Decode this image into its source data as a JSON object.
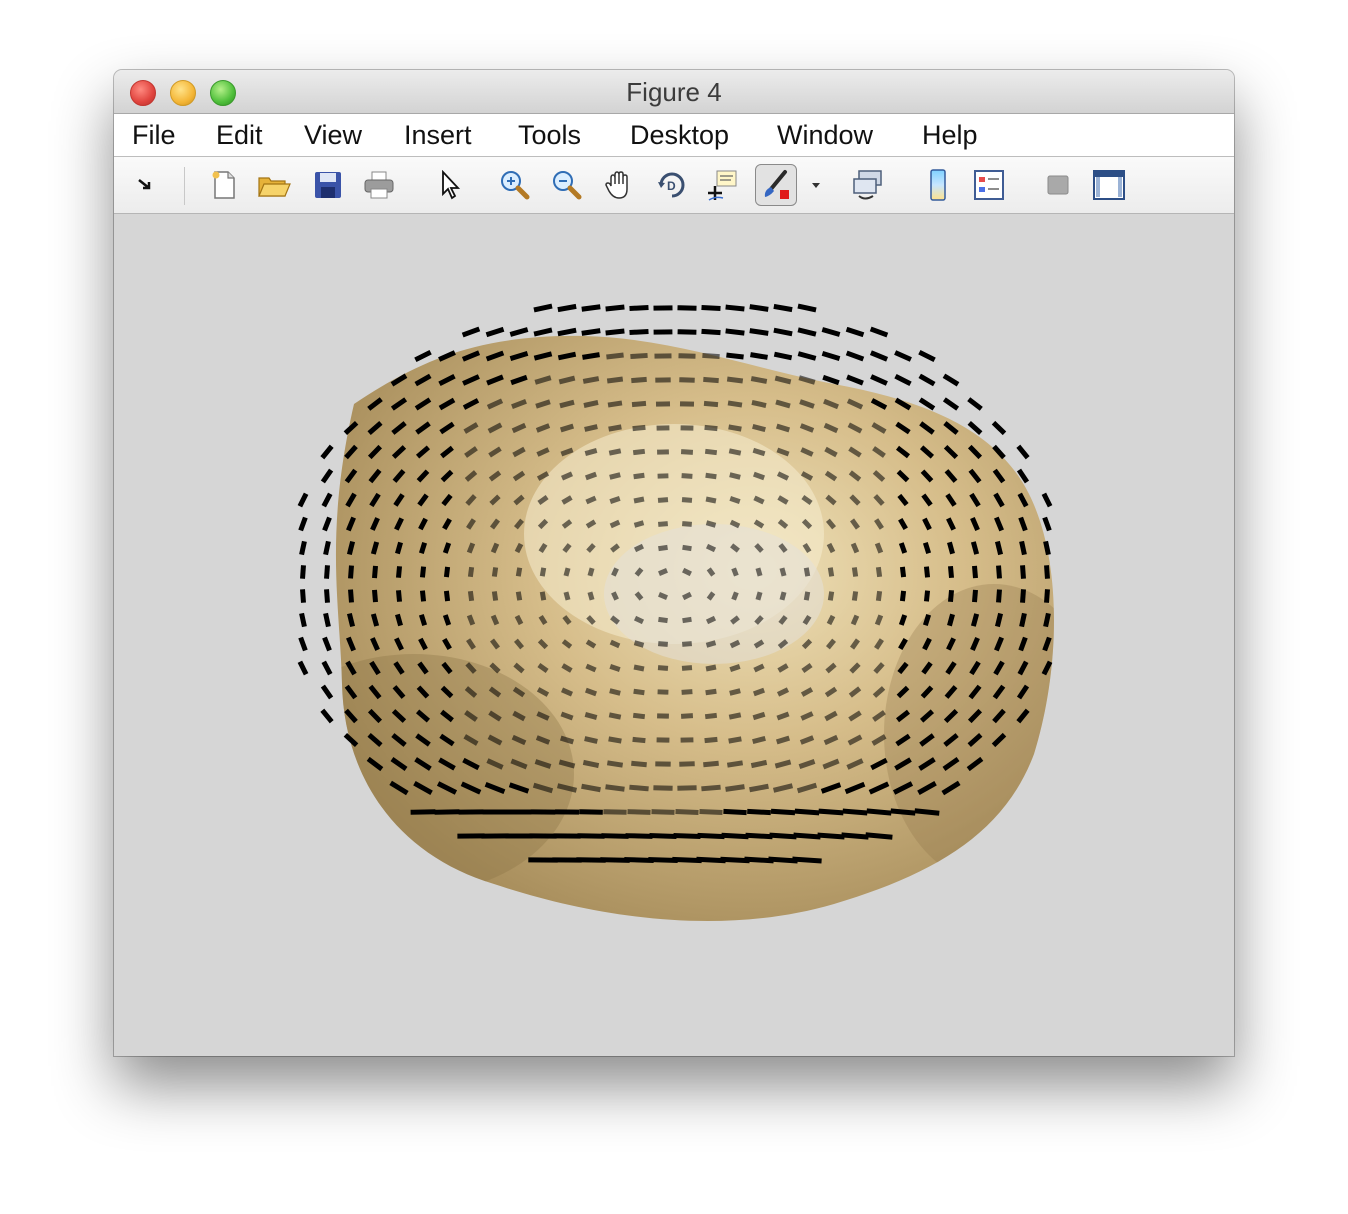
{
  "window": {
    "title": "Figure 4"
  },
  "menu": [
    "File",
    "Edit",
    "View",
    "Insert",
    "Tools",
    "Desktop",
    "Window",
    "Help"
  ],
  "toolbar": {
    "buttons": [
      {
        "name": "dock-icon"
      },
      {
        "name": "new-figure-icon"
      },
      {
        "name": "open-file-icon"
      },
      {
        "name": "save-icon"
      },
      {
        "name": "print-icon"
      },
      {
        "name": "edit-plot-pointer-icon"
      },
      {
        "name": "zoom-in-icon"
      },
      {
        "name": "zoom-out-icon"
      },
      {
        "name": "pan-hand-icon"
      },
      {
        "name": "rotate-3d-icon"
      },
      {
        "name": "data-cursor-icon"
      },
      {
        "name": "brush-icon",
        "active": true
      },
      {
        "name": "brush-dropdown-icon"
      },
      {
        "name": "link-plot-icon"
      },
      {
        "name": "colorbar-icon"
      },
      {
        "name": "legend-icon"
      },
      {
        "name": "hide-plot-tools-icon"
      },
      {
        "name": "show-plot-tools-icon"
      }
    ]
  },
  "colors": {
    "surface_base": "#c8ad7a",
    "surface_highlight": "#efe1b8",
    "vectors": "#000000",
    "background": "#d6d6d6"
  },
  "plot": {
    "surface": "tan shaded 3D surface",
    "glyphs": "black quiver vectors"
  }
}
